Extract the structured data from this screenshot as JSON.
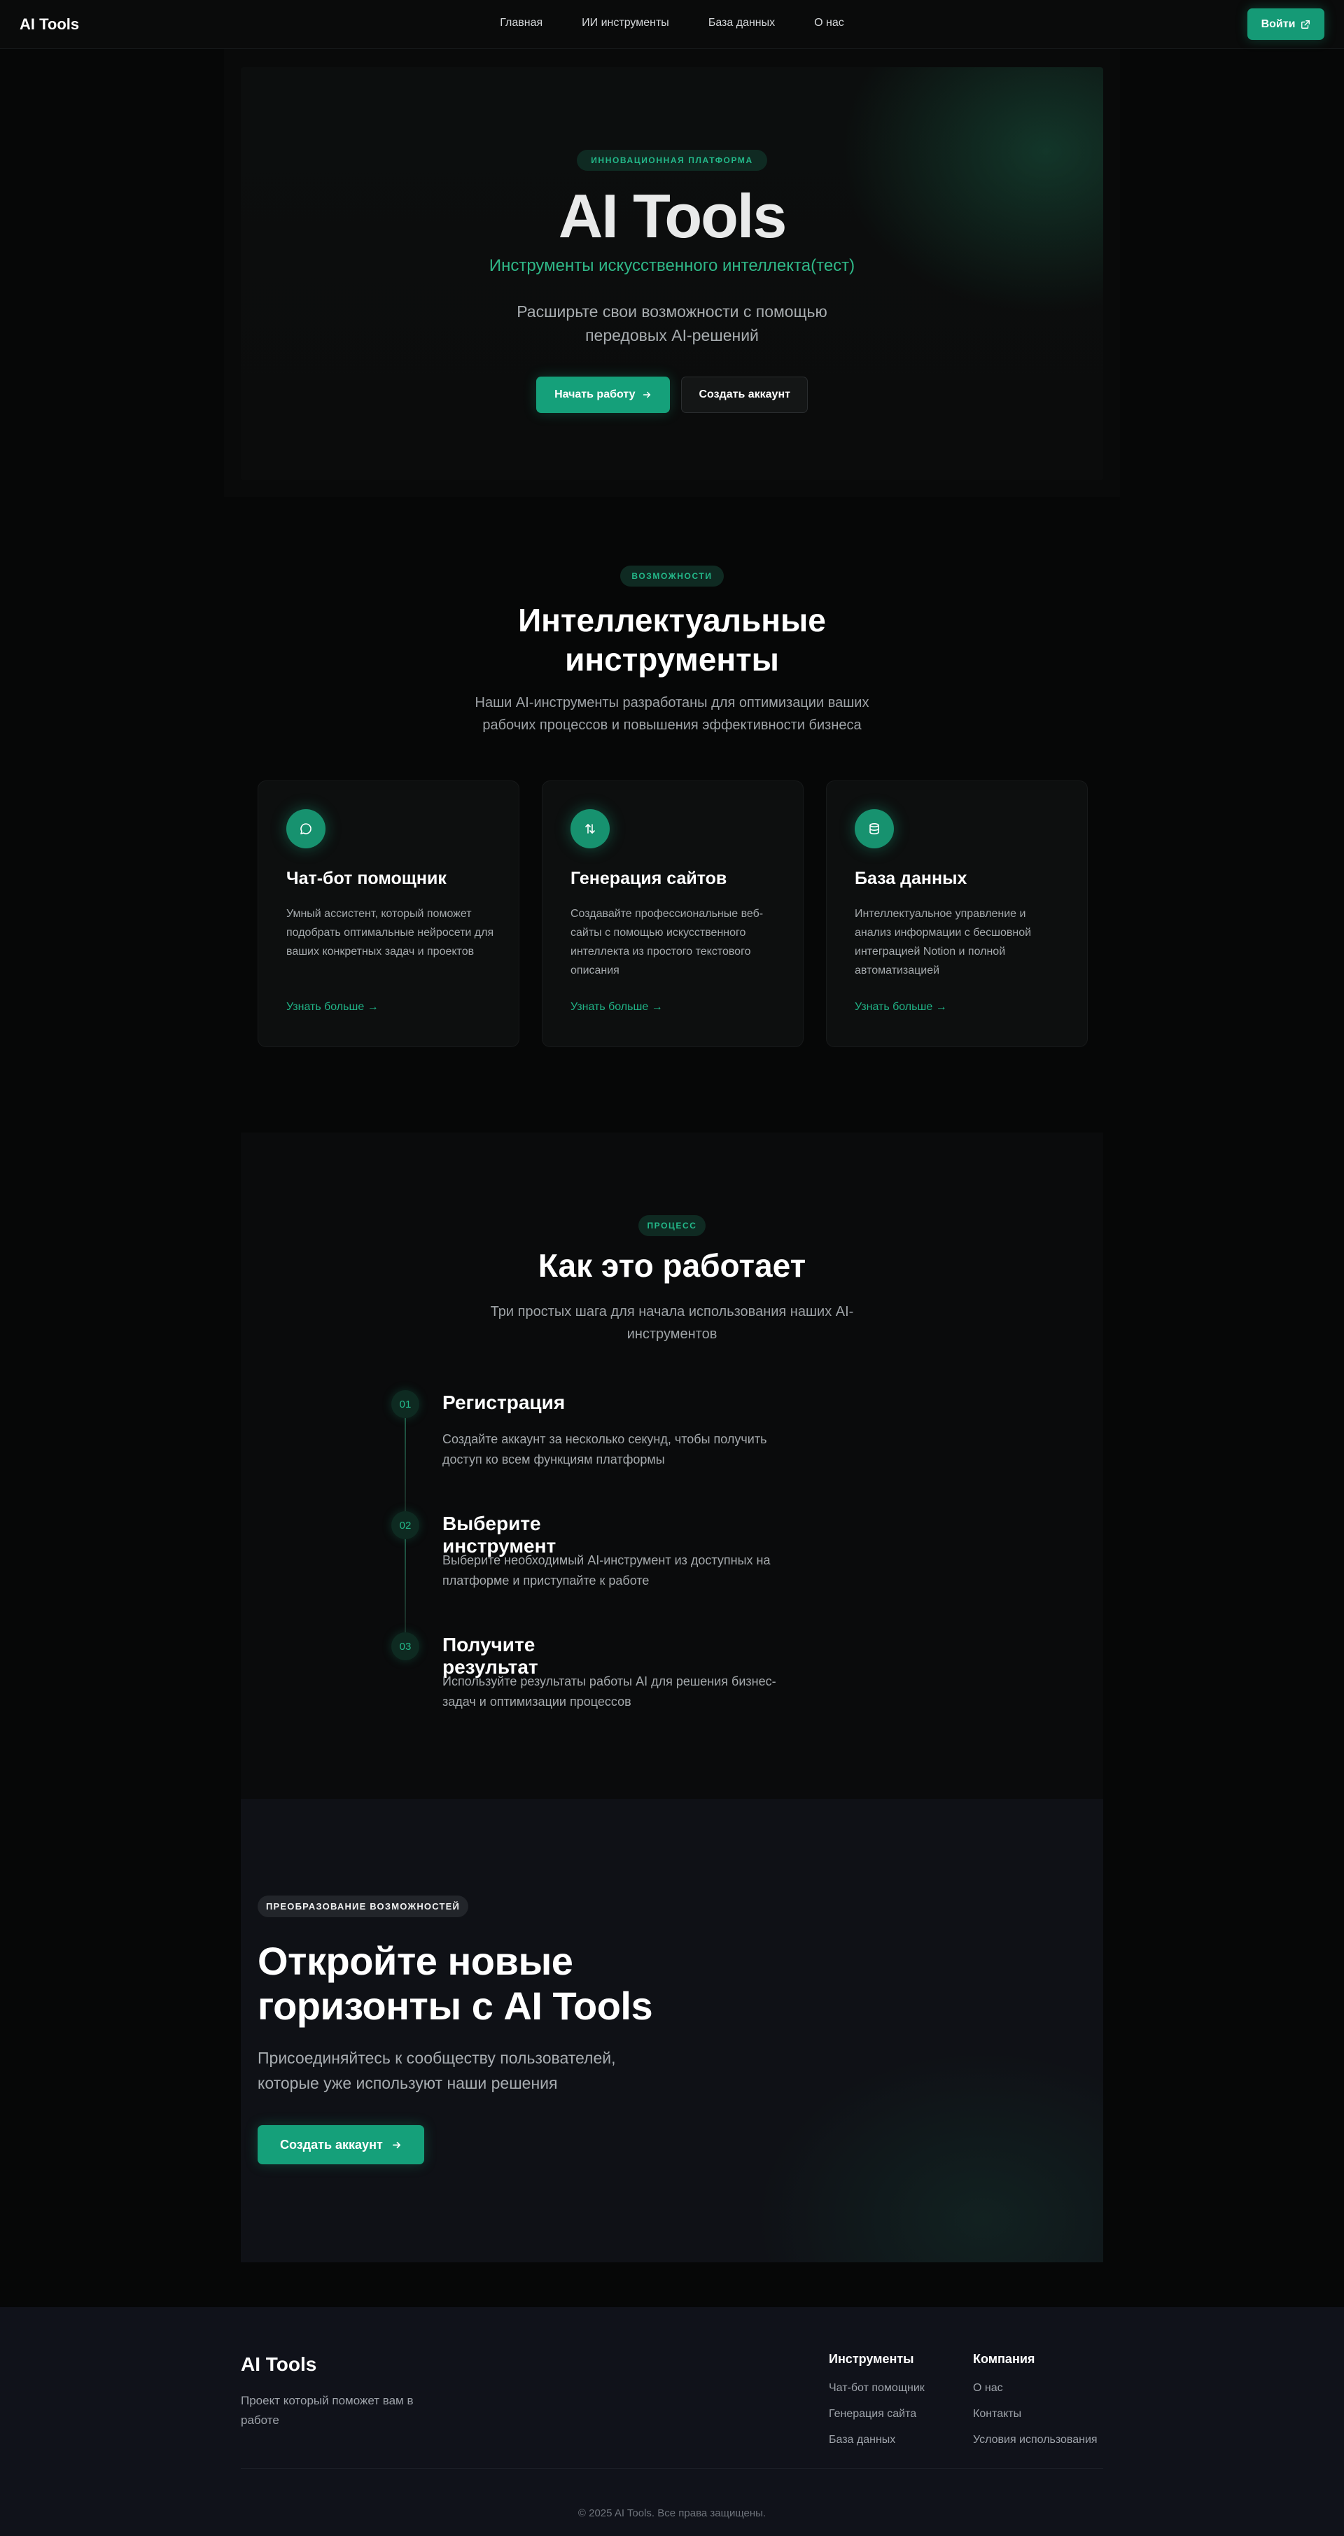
{
  "nav": {
    "brand": "AI Tools",
    "links": [
      "Главная",
      "ИИ инструменты",
      "База данных",
      "О нас"
    ],
    "login_label": "Войти"
  },
  "hero": {
    "badge": "ИННОВАЦИОННАЯ ПЛАТФОРМА",
    "title": "AI Tools",
    "subtitle": "Инструменты искусственного интеллекта(тест)",
    "description": "Расширьте свои возможности с помощью передовых AI-решений",
    "primary_label": "Начать работу",
    "secondary_label": "Создать аккаунт"
  },
  "features": {
    "badge": "ВОЗМОЖНОСТИ",
    "title": "Интеллектуальные инструменты",
    "description": "Наши AI-инструменты разработаны для оптимизации ваших рабочих процессов и повышения эффективности бизнеса",
    "cards": [
      {
        "icon": "chat-bubble-icon",
        "title": "Чат-бот помощник",
        "text": "Умный ассистент, который поможет подобрать оптимальные нейросети для ваших конкретных задач и проектов",
        "link": "Узнать больше →"
      },
      {
        "icon": "arrows-updown-icon",
        "title": "Генерация сайтов",
        "text": "Создавайте профессиональные веб-сайты с помощью искусственного интеллекта из простого текстового описания",
        "link": "Узнать больше →"
      },
      {
        "icon": "database-icon",
        "title": "База данных",
        "text": "Интеллектуальное управление и анализ информации с бесшовной интеграцией Notion и полной автоматизацией",
        "link": "Узнать больше →"
      }
    ]
  },
  "process": {
    "badge": "ПРОЦЕСС",
    "title": "Как это работает",
    "description": "Три простых шага для начала использования наших AI-инструментов",
    "steps": [
      {
        "num": "01",
        "title": "Регистрация",
        "text": "Создайте аккаунт за несколько секунд, чтобы получить доступ ко всем функциям платформы"
      },
      {
        "num": "02",
        "title": "Выберите инструмент",
        "text": "Выберите необходимый AI-инструмент из доступных на платформе и приступайте к работе"
      },
      {
        "num": "03",
        "title": "Получите результат",
        "text": "Используйте результаты работы AI для решения бизнес-задач и оптимизации процессов"
      }
    ]
  },
  "cta": {
    "badge": "ПРЕОБРАЗОВАНИЕ ВОЗМОЖНОСТЕЙ",
    "title": "Откройте новые горизонты с AI Tools",
    "description": "Присоединяйтесь к сообществу пользователей, которые уже используют наши решения",
    "button_label": "Создать аккаунт"
  },
  "footer": {
    "brand": "AI Tools",
    "description": "Проект который поможет вам в работе",
    "columns": [
      {
        "title": "Инструменты",
        "links": [
          "Чат-бот помощник",
          "Генерация сайта",
          "База данных"
        ]
      },
      {
        "title": "Компания",
        "links": [
          "О нас",
          "Контакты",
          "Условия использования"
        ]
      }
    ],
    "copyright": "© 2025 AI Tools. Все права защищены."
  },
  "colors": {
    "accent": "#15a07a",
    "accent_text": "#23b889",
    "background": "#060707",
    "footer_bg": "#10121a"
  }
}
